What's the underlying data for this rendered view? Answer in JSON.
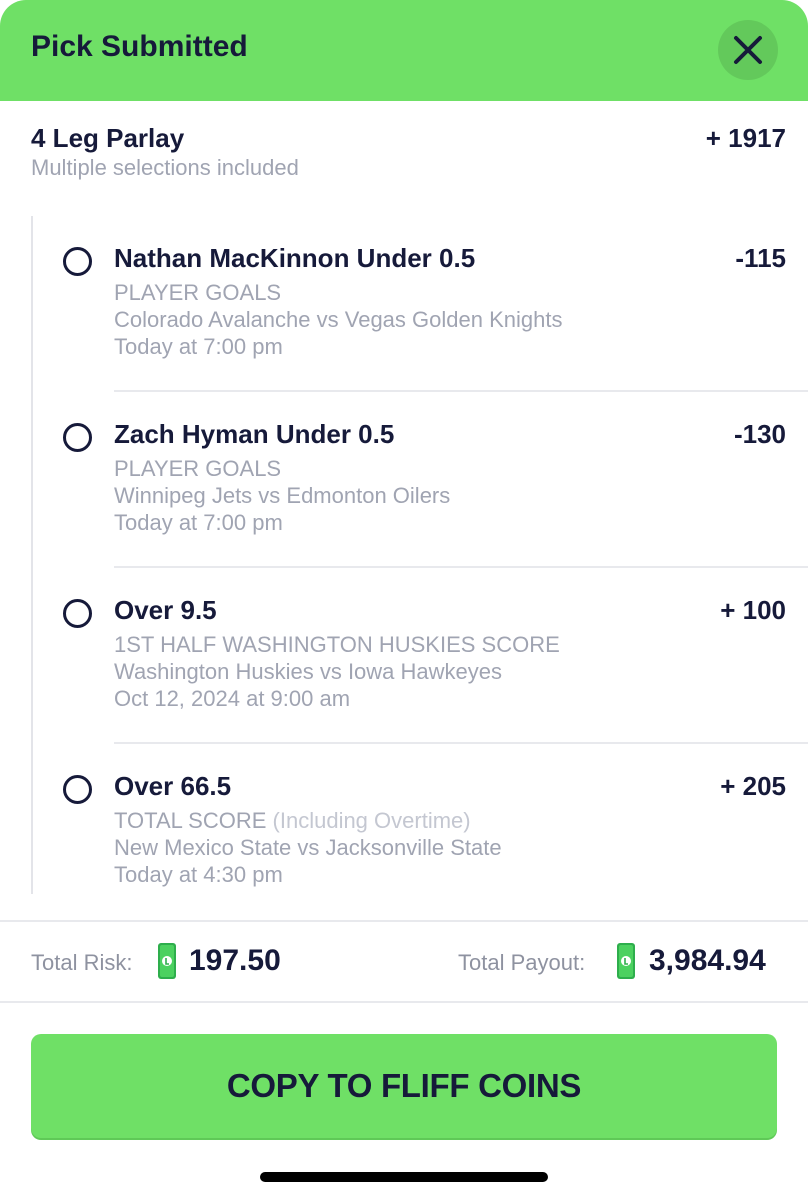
{
  "header": {
    "title": "Pick Submitted",
    "close_icon": "close-icon",
    "accent_color": "#6fe066"
  },
  "parlay": {
    "title": "4 Leg Parlay",
    "subtitle": "Multiple selections included",
    "odds": "+ 1917"
  },
  "legs": [
    {
      "title": "Nathan MacKinnon Under 0.5",
      "odds": "-115",
      "market": "PLAYER GOALS",
      "market_extra": "",
      "matchup": "Colorado Avalanche vs Vegas Golden Knights",
      "time": "Today at 7:00 pm"
    },
    {
      "title": "Zach Hyman Under 0.5",
      "odds": "-130",
      "market": "PLAYER GOALS",
      "market_extra": "",
      "matchup": "Winnipeg Jets vs Edmonton Oilers",
      "time": "Today at 7:00 pm"
    },
    {
      "title": "Over 9.5",
      "odds": "+ 100",
      "market": "1ST HALF WASHINGTON HUSKIES SCORE",
      "market_extra": "",
      "matchup": "Washington Huskies vs Iowa Hawkeyes",
      "time": "Oct 12, 2024 at 9:00 am"
    },
    {
      "title": "Over 66.5",
      "odds": "+ 205",
      "market": "TOTAL SCORE",
      "market_extra": "(Including Overtime)",
      "matchup": "New Mexico State vs Jacksonville State",
      "time": "Today at 4:30 pm"
    }
  ],
  "totals": {
    "risk_label": "Total Risk:",
    "risk_value": "197.50",
    "payout_label": "Total Payout:",
    "payout_value": "3,984.94",
    "coin_icon": "cash-coin-icon"
  },
  "cta": {
    "label": "COPY TO FLIFF COINS"
  }
}
